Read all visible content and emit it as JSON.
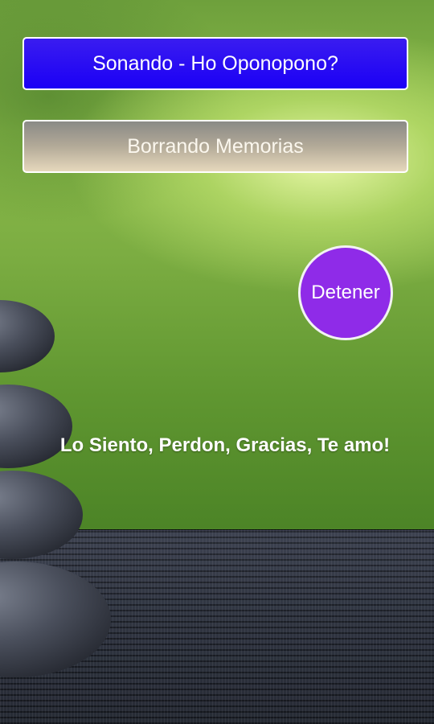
{
  "buttons": {
    "playing_label": "Sonando - Ho Oponopono?",
    "erasing_label": "Borrando Memorias",
    "stop_label": "Detener"
  },
  "mantra": "Lo Siento, Perdon, Gracias, Te amo!",
  "colors": {
    "playing_button": "#1b00f5",
    "erasing_button": "#b3aa98",
    "stop_button": "#8f2be8",
    "text": "#ffffff"
  },
  "icons": {
    "background": "zen-stones-bamboo-mat-image"
  }
}
